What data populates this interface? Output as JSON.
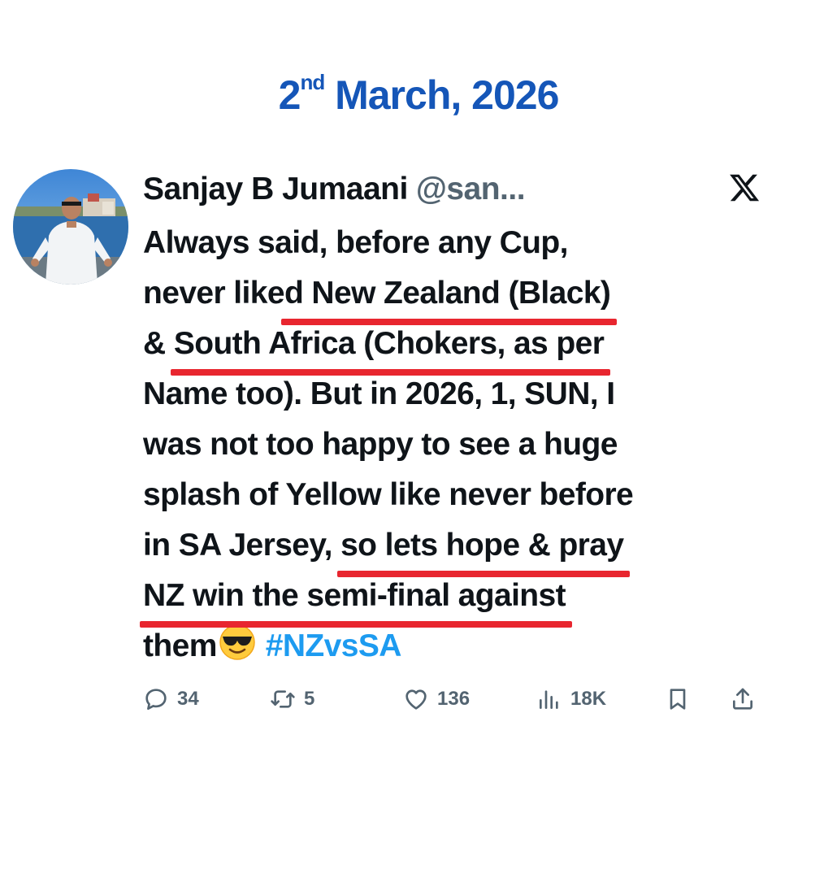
{
  "heading": {
    "day": "2",
    "ordinal_suffix": "nd",
    "rest": " March, 2026"
  },
  "colors": {
    "heading": "#1556b8",
    "text": "#0f1419",
    "secondary": "#536471",
    "hashtag": "#1d9bf0",
    "underline": "#e8262f"
  },
  "tweet": {
    "author_name": "Sanjay B Jumaani",
    "author_handle": "@san...",
    "platform_icon": "x-logo-icon",
    "body": {
      "l1": "Always said, before any Cup,",
      "l2_pre": "never like",
      "l2_hl": "d New Zealand (Black)",
      "l3_pre": "& ",
      "l3_hl": "South Africa (Chokers, as per",
      "l4": "Name too). But in 2026, 1, SUN, I",
      "l5": "was not too happy to see a huge",
      "l6": "splash of Yellow like never before",
      "l7_pre": "in SA Jersey, ",
      "l7_hl": "so lets hope & pray",
      "l8_hl": "NZ win the semi-final against",
      "l9_pre": "them",
      "emoji": "smiling-face-with-sunglasses-icon",
      "hashtag": "#NZvsSA"
    },
    "actions": {
      "replies": "34",
      "reposts": "5",
      "likes": "136",
      "views": "18K"
    }
  }
}
